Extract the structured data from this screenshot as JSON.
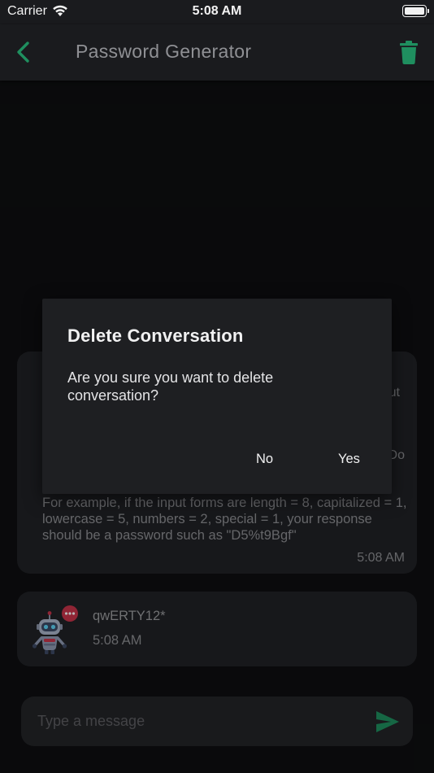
{
  "status_bar": {
    "carrier": "Carrier",
    "time": "5:08 AM"
  },
  "header": {
    "title": "Password Generator",
    "back_icon": "chevron-left-icon",
    "delete_icon": "trash-icon",
    "accent_color": "#1f8f5f"
  },
  "chat": {
    "messages": [
      {
        "peek_line_1": "ut",
        "peek_line_2": "Do",
        "text": "For example, if the input forms are length = 8, capitalized = 1, lowercase = 5, numbers = 2, special = 1, your response should be a password such as \"D5%t9Bgf\"",
        "time": "5:08 AM"
      },
      {
        "avatar_icon": "robot-icon",
        "text": "qwERTY12*",
        "time": "5:08 AM"
      }
    ]
  },
  "input": {
    "placeholder": "Type a message",
    "value": "",
    "send_icon": "send-icon"
  },
  "dialog": {
    "title": "Delete Conversation",
    "message": "Are you sure you want to delete conversation?",
    "no_label": "No",
    "yes_label": "Yes"
  }
}
